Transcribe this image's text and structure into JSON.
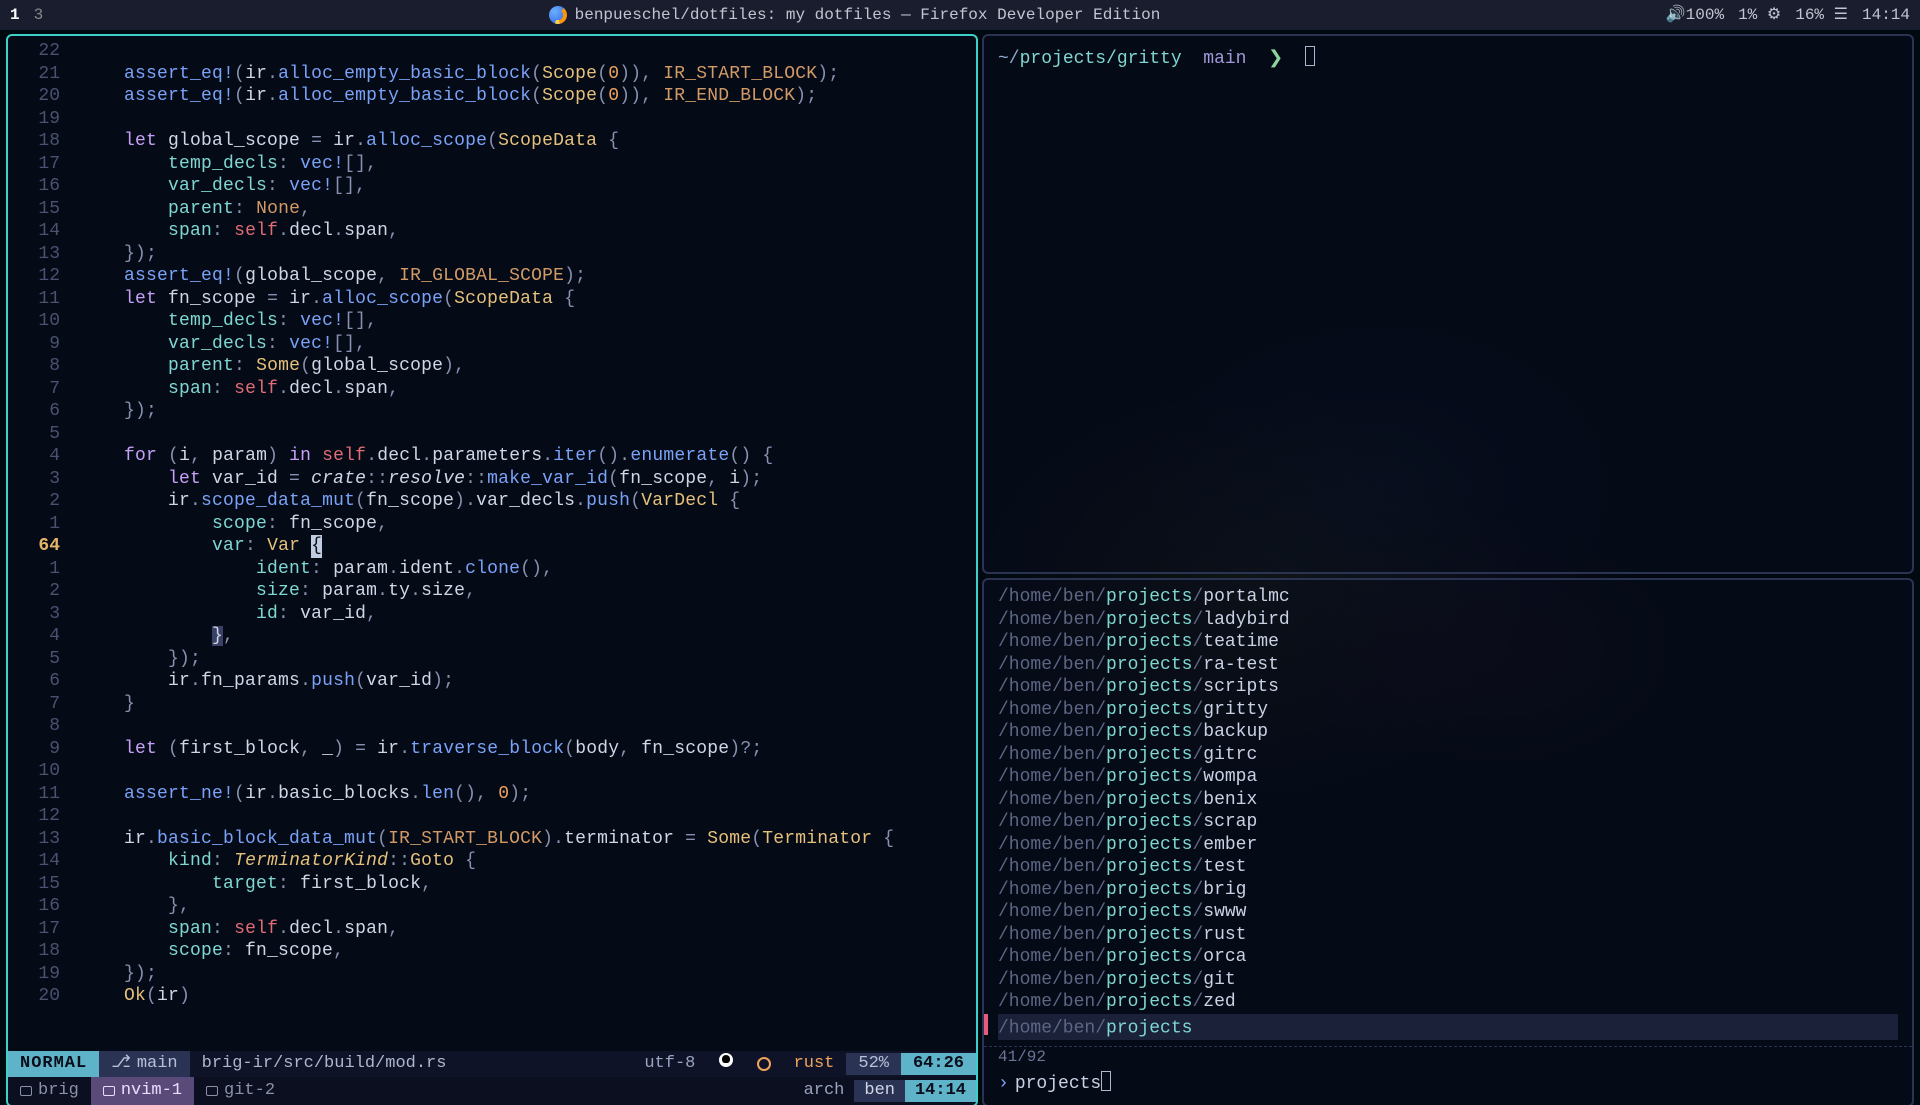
{
  "topbar": {
    "workspaces": [
      "1",
      "3"
    ],
    "active_ws_index": 0,
    "title": "benpueschel/dotfiles: my dotfiles — Firefox Developer Edition",
    "right": {
      "volume": "100%",
      "cpu": "1%",
      "battery": "16%",
      "time": "14:14"
    }
  },
  "editor": {
    "gutter_top": [
      "22",
      "21",
      "20",
      "19",
      "18",
      "17",
      "16",
      "15",
      "14",
      "13",
      "12",
      "11",
      "10",
      "9",
      "8",
      "7",
      "6",
      "5",
      "4",
      "3",
      "2",
      "1"
    ],
    "gutter_current": "64",
    "gutter_bottom": [
      "1",
      "2",
      "3",
      "4",
      "5",
      "6",
      "7",
      "8",
      "9",
      "10",
      "11",
      "12",
      "13",
      "14",
      "15",
      "16",
      "17",
      "18",
      "19",
      "20"
    ],
    "status": {
      "mode": "NORMAL",
      "branch_icon": "",
      "branch": "main",
      "file": "brig-ir/src/build/mod.rs",
      "encoding": "utf-8",
      "filetype": "rust",
      "percent": "52%",
      "position": "64:26"
    },
    "tabs": {
      "items": [
        {
          "label": "brig",
          "selected": false
        },
        {
          "label": "nvim-1",
          "selected": true
        },
        {
          "label": "git-2",
          "selected": false
        }
      ],
      "host": "arch",
      "user": "ben",
      "time": "14:14"
    }
  },
  "shell": {
    "cwd_prefix": "~/",
    "cwd_hl": "projects/gritty",
    "branch": "main",
    "prompt_char": "❯"
  },
  "fuzzy": {
    "items": [
      "portalmc",
      "ladybird",
      "teatime",
      "ra-test",
      "scripts",
      "gritty",
      "backup",
      "gitrc",
      "wompa",
      "benix",
      "scrap",
      "ember",
      "test",
      "brig",
      "swww",
      "rust",
      "orca",
      "git",
      "zed"
    ],
    "selected": {
      "prefix": "/home/ben/",
      "hl": "projects"
    },
    "count": "41/92",
    "query": "projects"
  }
}
